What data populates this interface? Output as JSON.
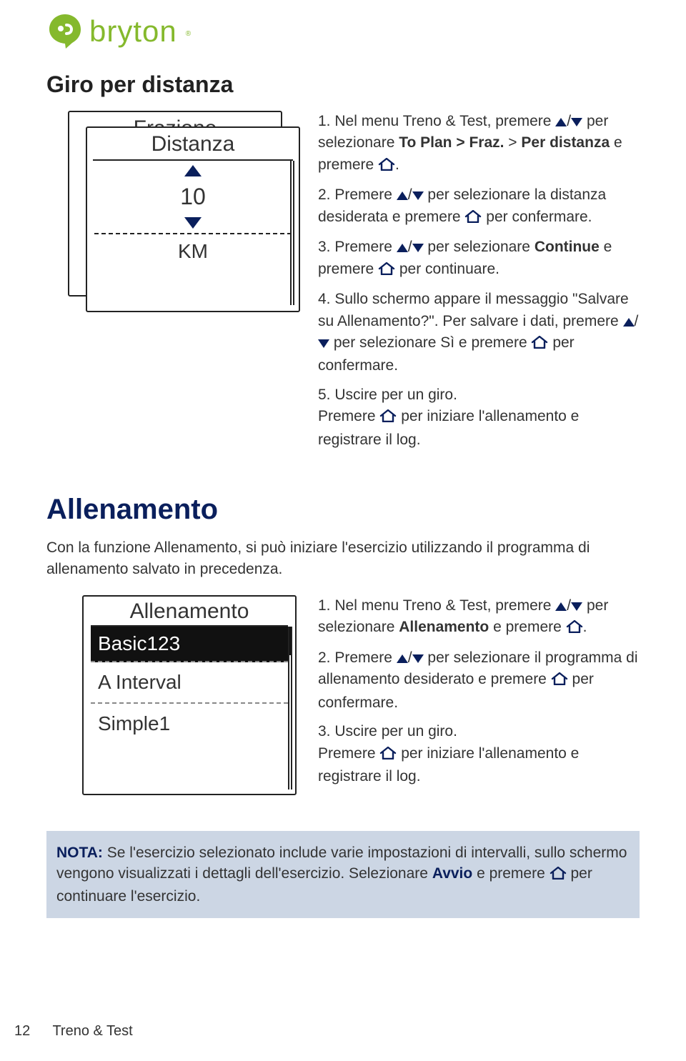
{
  "brand": {
    "name": "bryton"
  },
  "section1": {
    "title": "Giro per distanza",
    "device": {
      "back_title": "Frazione",
      "front_title": "Distanza",
      "value": "10",
      "unit": "KM"
    },
    "steps": {
      "s1a": "Nel menu Treno & Test, premere ",
      "s1b": " per selezionare ",
      "s1bold": "To Plan > Fraz.",
      "s1c": " > ",
      "s1bold2": "Per distanza",
      "s1d": " e premere ",
      "s1e": ".",
      "s2a": "Premere ",
      "s2b": " per selezionare la distanza desiderata e premere ",
      "s2c": " per confermare.",
      "s3a": "Premere ",
      "s3b": " per selezionare ",
      "s3bold": "Continue",
      "s3c": " e premere ",
      "s3d": " per continuare.",
      "s4a": "Sullo schermo appare il messaggio \"Salvare su Allenamento?\". Per salvare i dati, premere ",
      "s4b": " per selezionare Sì e premere ",
      "s4c": " per confermare.",
      "s5a": "Uscire per un giro.",
      "s5b": "Premere ",
      "s5c": " per iniziare l'allenamento e registrare il log."
    }
  },
  "section2": {
    "title": "Allenamento",
    "intro": "Con la funzione Allenamento, si può iniziare l'esercizio utilizzando il programma di allenamento salvato in precedenza.",
    "device": {
      "title": "Allenamento",
      "selected": "Basic123",
      "item2": "A Interval",
      "item3": "Simple1"
    },
    "steps": {
      "s1a": "Nel menu Treno & Test, premere ",
      "s1b": " per selezionare ",
      "s1bold": "Allenamento",
      "s1c": " e premere ",
      "s1d": ".",
      "s2a": "Premere ",
      "s2b": " per selezionare il programma di allenamento desiderato e premere ",
      "s2c": " per confermare.",
      "s3a": "Uscire per un giro.",
      "s3b": "Premere ",
      "s3c": " per iniziare l'allenamento e registrare il log."
    }
  },
  "note": {
    "label": "NOTA:",
    "text1": " Se l'esercizio selezionato include varie impostazioni di intervalli, sullo schermo vengono visualizzati i dettagli dell'esercizio. Selezionare ",
    "key": "Avvio",
    "text2": " e premere ",
    "text3": " per continuare l'esercizio."
  },
  "footer": {
    "page": "12",
    "section": "Treno & Test"
  }
}
